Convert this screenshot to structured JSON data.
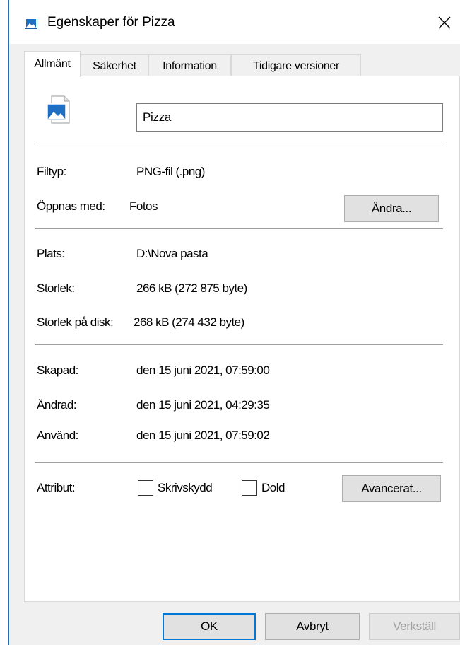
{
  "window": {
    "title": "Egenskaper för Pizza",
    "close_symbol": "✕"
  },
  "tabs": [
    {
      "label": "Allmänt",
      "active": true
    },
    {
      "label": "Säkerhet",
      "active": false
    },
    {
      "label": "Information",
      "active": false
    },
    {
      "label": "Tidigare versioner",
      "active": false
    }
  ],
  "general": {
    "file_name": "Pizza",
    "file_type_label": "Filtyp:",
    "file_type_value": "PNG-fil (.png)",
    "opens_with_label": "Öppnas med:",
    "opens_with_value": "Fotos",
    "change_button": "Ändra...",
    "location_label": "Plats:",
    "location_value": "D:\\Nova pasta",
    "size_label": "Storlek:",
    "size_value": "266 kB (272 875 byte)",
    "size_on_disk_label": "Storlek på disk:",
    "size_on_disk_value": "268 kB (274 432 byte)",
    "created_label": "Skapad:",
    "created_value": "den 15 juni 2021, 07:59:00",
    "modified_label": "Ändrad:",
    "modified_value": "den 15 juni 2021, 04:29:35",
    "accessed_label": "Använd:",
    "accessed_value": "den 15 juni 2021, 07:59:02",
    "attributes_label": "Attribut:",
    "readonly_label": "Skrivskydd",
    "readonly_checked": false,
    "hidden_label": "Dold",
    "hidden_checked": false,
    "advanced_button": "Avancerat..."
  },
  "footer": {
    "ok_button": "OK",
    "cancel_button": "Avbryt",
    "apply_button": "Verkställ"
  },
  "colors": {
    "accent": "#0078d7",
    "window_edge": "#2b6cb0",
    "dialog_bg": "#f0f0f0"
  },
  "icons": {
    "title_icon": "image-file-icon",
    "file_icon": "image-file-icon",
    "close": "close-icon"
  }
}
